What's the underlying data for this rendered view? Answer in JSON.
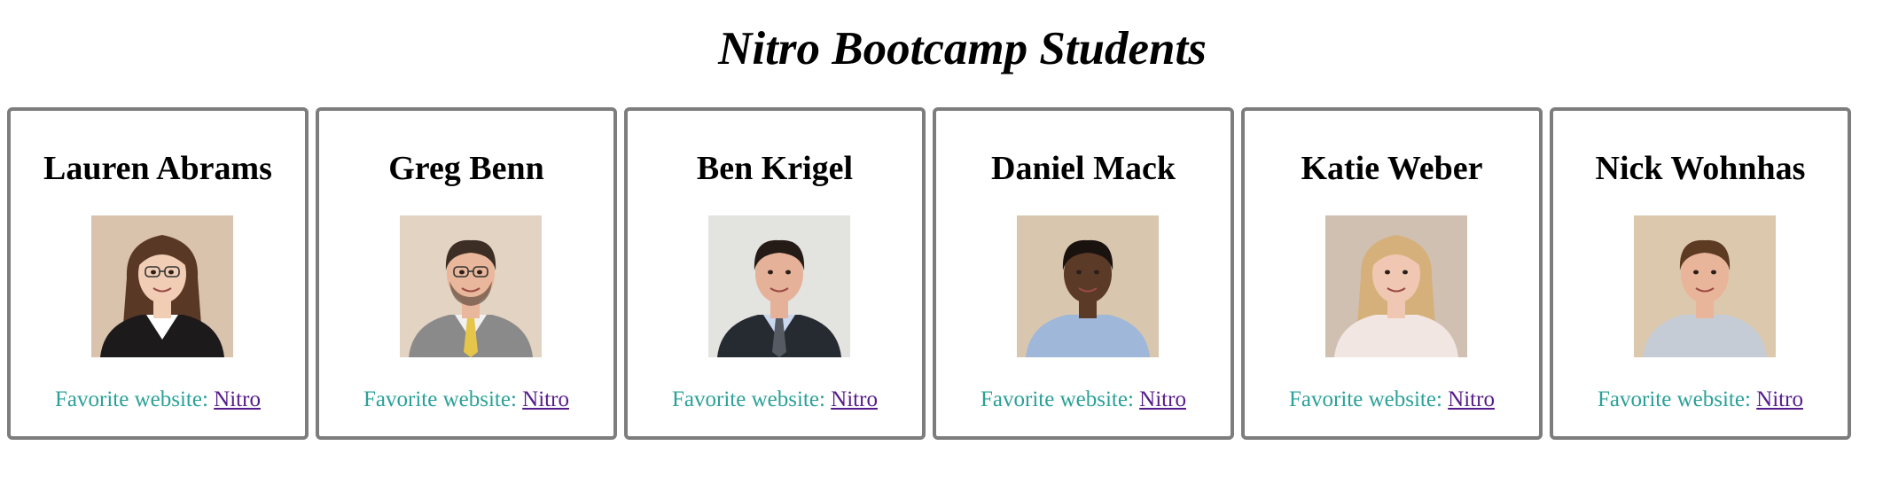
{
  "page": {
    "title": "Nitro Bootcamp Students"
  },
  "students": [
    {
      "name": "Lauren Abrams",
      "favorite_label": "Favorite website:",
      "link_text": "Nitro",
      "photo": {
        "bg": "#d9c3ad",
        "skin": "#f1cdb5",
        "hair": "#5a3826",
        "suit": "#1c1a1a",
        "shirt": "#ffffff",
        "long_hair": true,
        "glasses": true
      }
    },
    {
      "name": "Greg Benn",
      "favorite_label": "Favorite website:",
      "link_text": "Nitro",
      "photo": {
        "bg": "#e2d3c2",
        "skin": "#e9b79b",
        "hair": "#3c2e24",
        "suit": "#8a8a8a",
        "shirt": "#f1f1f1",
        "tie": "#e6c64a",
        "glasses": true,
        "beard": true
      }
    },
    {
      "name": "Ben Krigel",
      "favorite_label": "Favorite website:",
      "link_text": "Nitro",
      "photo": {
        "bg": "#e3e3e0",
        "skin": "#e5b199",
        "hair": "#241a16",
        "suit": "#262a31",
        "shirt": "#c9d8ef",
        "tie": "#565a62"
      }
    },
    {
      "name": "Daniel Mack",
      "favorite_label": "Favorite website:",
      "link_text": "Nitro",
      "photo": {
        "bg": "#d8c7ae",
        "skin": "#5b3a28",
        "hair": "#1a120e",
        "suit": "#9fb7d8",
        "shirt": "#9fb7d8"
      }
    },
    {
      "name": "Katie Weber",
      "favorite_label": "Favorite website:",
      "link_text": "Nitro",
      "photo": {
        "bg": "#cfc0b2",
        "skin": "#f0c7b2",
        "hair": "#d6b07a",
        "suit": "#f1e6e2",
        "shirt": "#f1e6e2",
        "long_hair": true
      }
    },
    {
      "name": "Nick Wohnhas",
      "favorite_label": "Favorite website:",
      "link_text": "Nitro",
      "photo": {
        "bg": "#dcc8ad",
        "skin": "#e9b59a",
        "hair": "#5c3b22",
        "suit": "#c6ccd6",
        "shirt": "#c6ccd6"
      }
    }
  ]
}
